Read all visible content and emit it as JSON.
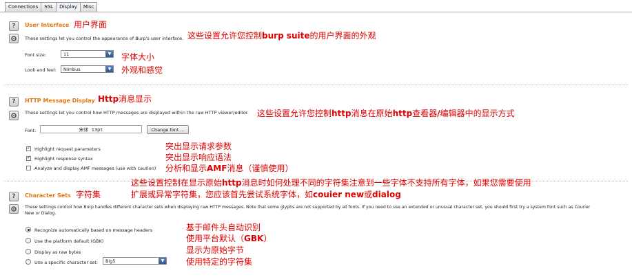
{
  "tabs": [
    "Connections",
    "SSL",
    "Display",
    "Misc"
  ],
  "active_tab": "Display",
  "user_interface": {
    "title": "User Interface",
    "annotation_title": "用户界面",
    "description": "These settings let you control the appearance of Burp's user interface.",
    "annotation_desc_prefix": "这些设置允许您控制",
    "annotation_desc_bold": "burp suite",
    "annotation_desc_suffix": "的用户界面的外观",
    "font_size_label": "Font size:",
    "font_size_value": "11",
    "font_size_annotation": "字体大小",
    "look_feel_label": "Look and feel:",
    "look_feel_value": "Nimbus",
    "look_feel_annotation": "外观和感觉"
  },
  "http_display": {
    "title": "HTTP Message Display",
    "annotation_title": "Http",
    "annotation_title_suffix": "消息显示",
    "description": "These settings let you control how HTTP messages are displayed within the raw HTTP viewer/editor.",
    "annotation_desc": "这些设置允许您控制",
    "annotation_desc_b1": "http",
    "annotation_desc_m": "消息在原始",
    "annotation_desc_b2": "http",
    "annotation_desc_s": "查看器",
    "annotation_desc_b3": "/",
    "annotation_desc_e": "编辑器中的显示方式",
    "font_label": "Font:",
    "font_value": "宋体 13pt",
    "change_font_button": "Change font ...",
    "checkboxes": [
      {
        "label": "Highlight request parameters",
        "checked": true,
        "annotation": "突出显示请求参数"
      },
      {
        "label": "Highlight response syntax",
        "checked": true,
        "annotation": "突出显示响应语法"
      },
      {
        "label": "Analyze and display AMF messages (use with caution)",
        "checked": false,
        "annotation_pre": "分析和显示",
        "annotation_bold": "AMF",
        "annotation_post": "消息（谨慎使用）"
      }
    ]
  },
  "charsets": {
    "title": "Character Sets",
    "annotation_title": "字符集",
    "annotation_line1_a": "这些设置控制在显示原始",
    "annotation_line1_b": "http",
    "annotation_line1_c": "消息时如何处理不同的字符集注意到一些字体不支持所有字体，如果您需要使用",
    "annotation_line2_a": "扩展或异常字符集，您应该首先尝试系统字体，如",
    "annotation_line2_b": "couier new",
    "annotation_line2_c": "或",
    "annotation_line2_d": "dialog",
    "description_line1": "These settings control how Burp handles different character sets when displaying raw HTTP messages. Note that some glyphs are not supported by all fonts. If you need to use an extended or unusual character set, you should first try a system font such as Courier",
    "description_line2": "New or Dialog.",
    "options": [
      {
        "label": "Recognize automatically based on message headers",
        "selected": true,
        "annotation": "基于邮件头自动识别"
      },
      {
        "label": "Use the platform default (GBK)",
        "selected": false,
        "annotation_pre": "使用平台默认（",
        "annotation_bold": "GBK",
        "annotation_post": "）"
      },
      {
        "label": "Display as raw bytes",
        "selected": false,
        "annotation": "显示为原始字节"
      },
      {
        "label": "Use a specific character set:",
        "selected": false,
        "annotation": "使用特定的字符集"
      }
    ],
    "specific_charset_value": "Big5"
  }
}
